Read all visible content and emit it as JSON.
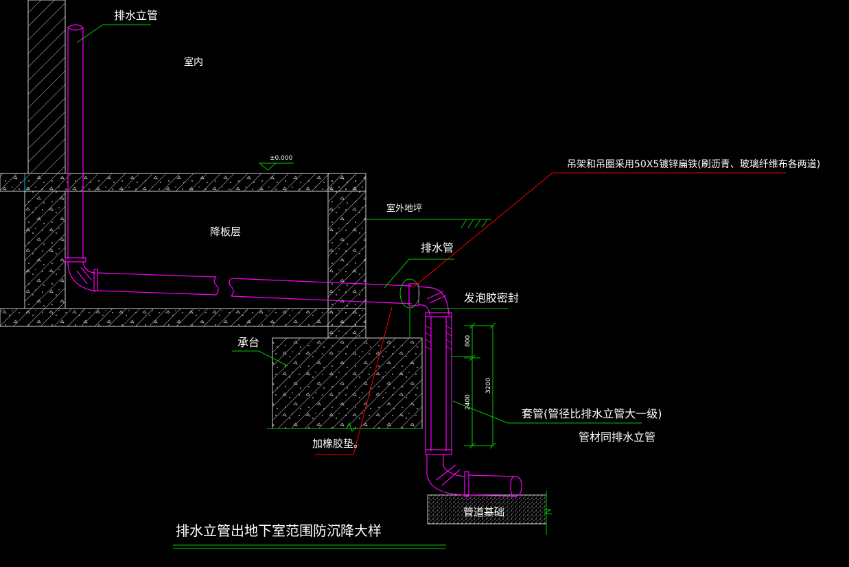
{
  "labels": {
    "drain_riser": "排水立管",
    "indoor": "室内",
    "elevation": "±0.000",
    "sunken_slab": "降板层",
    "outdoor_grade": "室外地坪",
    "drain_pipe": "排水管",
    "hanger_note": "吊架和吊圈采用50X5镀锌扁铁(刷沥青、玻璃纤维布各两道)",
    "foam_seal": "发泡胶密封",
    "pile_cap": "承台",
    "rubber_pad": "加橡胶垫。",
    "sleeve_note": "套管(管径比排水立管大一级)",
    "sleeve_material": "管材同排水立管",
    "pipe_base": "管道基础",
    "title": "排水立管出地下室范围防沉降大样"
  },
  "dimensions": {
    "dim_800": "800",
    "dim_2400": "2400",
    "dim_3200": "3200"
  },
  "colors": {
    "background": "#000000",
    "text": "#ffffff",
    "pipe": "#ff00ff",
    "leader_green": "#00cc00",
    "leader_red": "#ff0000",
    "structure": "#d0d0d0",
    "wall_outline": "#00ffff"
  }
}
